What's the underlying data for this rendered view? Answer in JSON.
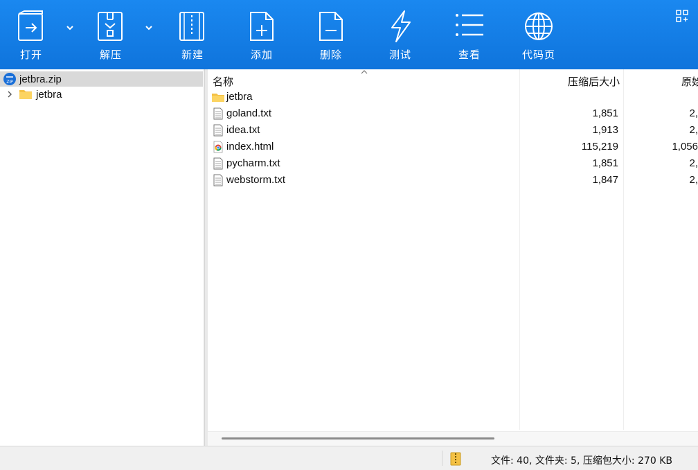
{
  "toolbar": {
    "buttons": [
      {
        "label": "打开",
        "icon": "open-icon"
      },
      {
        "label": "解压",
        "icon": "extract-icon"
      },
      {
        "label": "新建",
        "icon": "new-archive-icon"
      },
      {
        "label": "添加",
        "icon": "add-file-icon"
      },
      {
        "label": "删除",
        "icon": "delete-file-icon"
      },
      {
        "label": "测试",
        "icon": "test-lightning-icon"
      },
      {
        "label": "查看",
        "icon": "view-list-icon"
      },
      {
        "label": "代码页",
        "icon": "globe-icon"
      }
    ]
  },
  "tree": {
    "root": "jetbra.zip",
    "child": "jetbra"
  },
  "list": {
    "columns": {
      "name": "名称",
      "compressed": "压缩后大小",
      "original": "原始"
    },
    "rows": [
      {
        "name": "jetbra",
        "type": "folder",
        "compressed": "",
        "original": ""
      },
      {
        "name": "goland.txt",
        "type": "text",
        "compressed": "1,851",
        "original": "2,"
      },
      {
        "name": "idea.txt",
        "type": "text",
        "compressed": "1,913",
        "original": "2,"
      },
      {
        "name": "index.html",
        "type": "html",
        "compressed": "115,219",
        "original": "1,056"
      },
      {
        "name": "pycharm.txt",
        "type": "text",
        "compressed": "1,851",
        "original": "2,"
      },
      {
        "name": "webstorm.txt",
        "type": "text",
        "compressed": "1,847",
        "original": "2,"
      }
    ]
  },
  "status": {
    "text": "文件: 40, 文件夹: 5, 压缩包大小: 270 KB"
  },
  "colors": {
    "toolbar": "#1380e6",
    "selection": "#d9d9d9",
    "folder": "#f4c145"
  }
}
